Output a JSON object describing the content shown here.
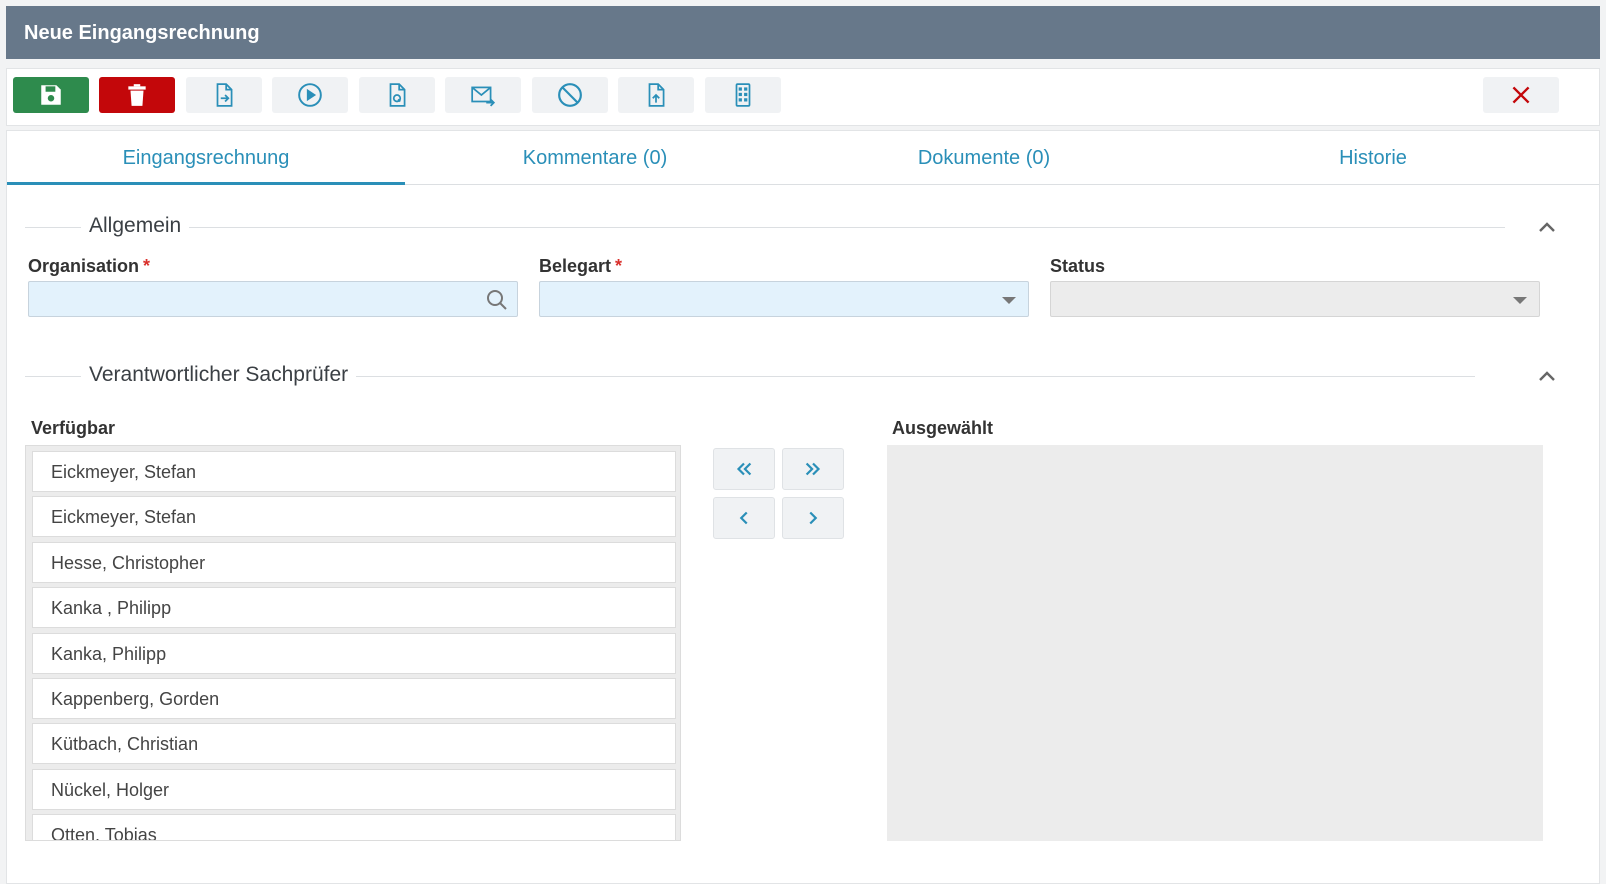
{
  "window": {
    "title": "Neue Eingangsrechnung"
  },
  "toolbar": {
    "buttons": [
      {
        "name": "save-icon"
      },
      {
        "name": "trash-icon"
      },
      {
        "name": "file-export-icon"
      },
      {
        "name": "play-circle-icon"
      },
      {
        "name": "file-search-icon"
      },
      {
        "name": "mail-forward-icon"
      },
      {
        "name": "ban-icon"
      },
      {
        "name": "file-upload-icon"
      },
      {
        "name": "grid-icon"
      },
      {
        "name": "close-icon"
      }
    ]
  },
  "tabs": [
    {
      "label": "Eingangsrechnung",
      "active": true
    },
    {
      "label": "Kommentare (0)",
      "active": false
    },
    {
      "label": "Dokumente (0)",
      "active": false
    },
    {
      "label": "Historie",
      "active": false
    }
  ],
  "general": {
    "title": "Allgemein",
    "organisation": {
      "label": "Organisation",
      "required": "*",
      "value": ""
    },
    "belegart": {
      "label": "Belegart",
      "required": "*",
      "value": ""
    },
    "status": {
      "label": "Status",
      "value": ""
    }
  },
  "reviewer": {
    "title": "Verantwortlicher Sachprüfer",
    "available_label": "Verfügbar",
    "selected_label": "Ausgewählt",
    "available": [
      "Eickmeyer, Stefan",
      "Eickmeyer, Stefan",
      "Hesse, Christopher",
      "Kanka , Philipp",
      "Kanka, Philipp",
      "Kappenberg, Gorden",
      "Kütbach, Christian",
      "Nückel, Holger",
      "Otten, Tobias"
    ],
    "selected": []
  },
  "colors": {
    "titlebar": "#67788a",
    "accent": "#2a8fb8",
    "save": "#2e8b4d",
    "delete": "#c3070a",
    "close": "#c3070a",
    "required": "#d9302c"
  }
}
